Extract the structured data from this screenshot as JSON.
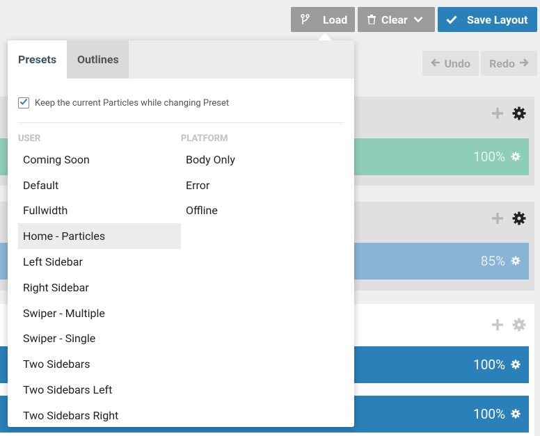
{
  "toolbar": {
    "load_label": "Load",
    "clear_label": "Clear",
    "save_label": "Save Layout",
    "undo_label": "Undo",
    "redo_label": "Redo"
  },
  "sections": [
    {
      "bar_percent": "100%",
      "bar_color": "#8ecdb7"
    },
    {
      "bar_percent": "85%",
      "bar_color": "#8ab4d6"
    },
    {
      "bar_percent": "100%",
      "bar_color": "#2a80b9"
    },
    {
      "bar_percent": "100%",
      "bar_color": "#2a80b9"
    }
  ],
  "dropdown": {
    "tabs": [
      "Presets",
      "Outlines"
    ],
    "keep_particles_label": "Keep the current Particles while changing Preset",
    "keep_particles_checked": true,
    "user_heading": "USER",
    "platform_heading": "PLATFORM",
    "user_items": [
      "Coming Soon",
      "Default",
      "Fullwidth",
      "Home - Particles",
      "Left Sidebar",
      "Right Sidebar",
      "Swiper - Multiple",
      "Swiper - Single",
      "Two Sidebars",
      "Two Sidebars Left",
      "Two Sidebars Right"
    ],
    "platform_items": [
      "Body Only",
      "Error",
      "Offline"
    ],
    "highlighted_item": "Home - Particles"
  },
  "colors": {
    "accent": "#2a80b9",
    "grey_button": "#9b9b9b"
  }
}
